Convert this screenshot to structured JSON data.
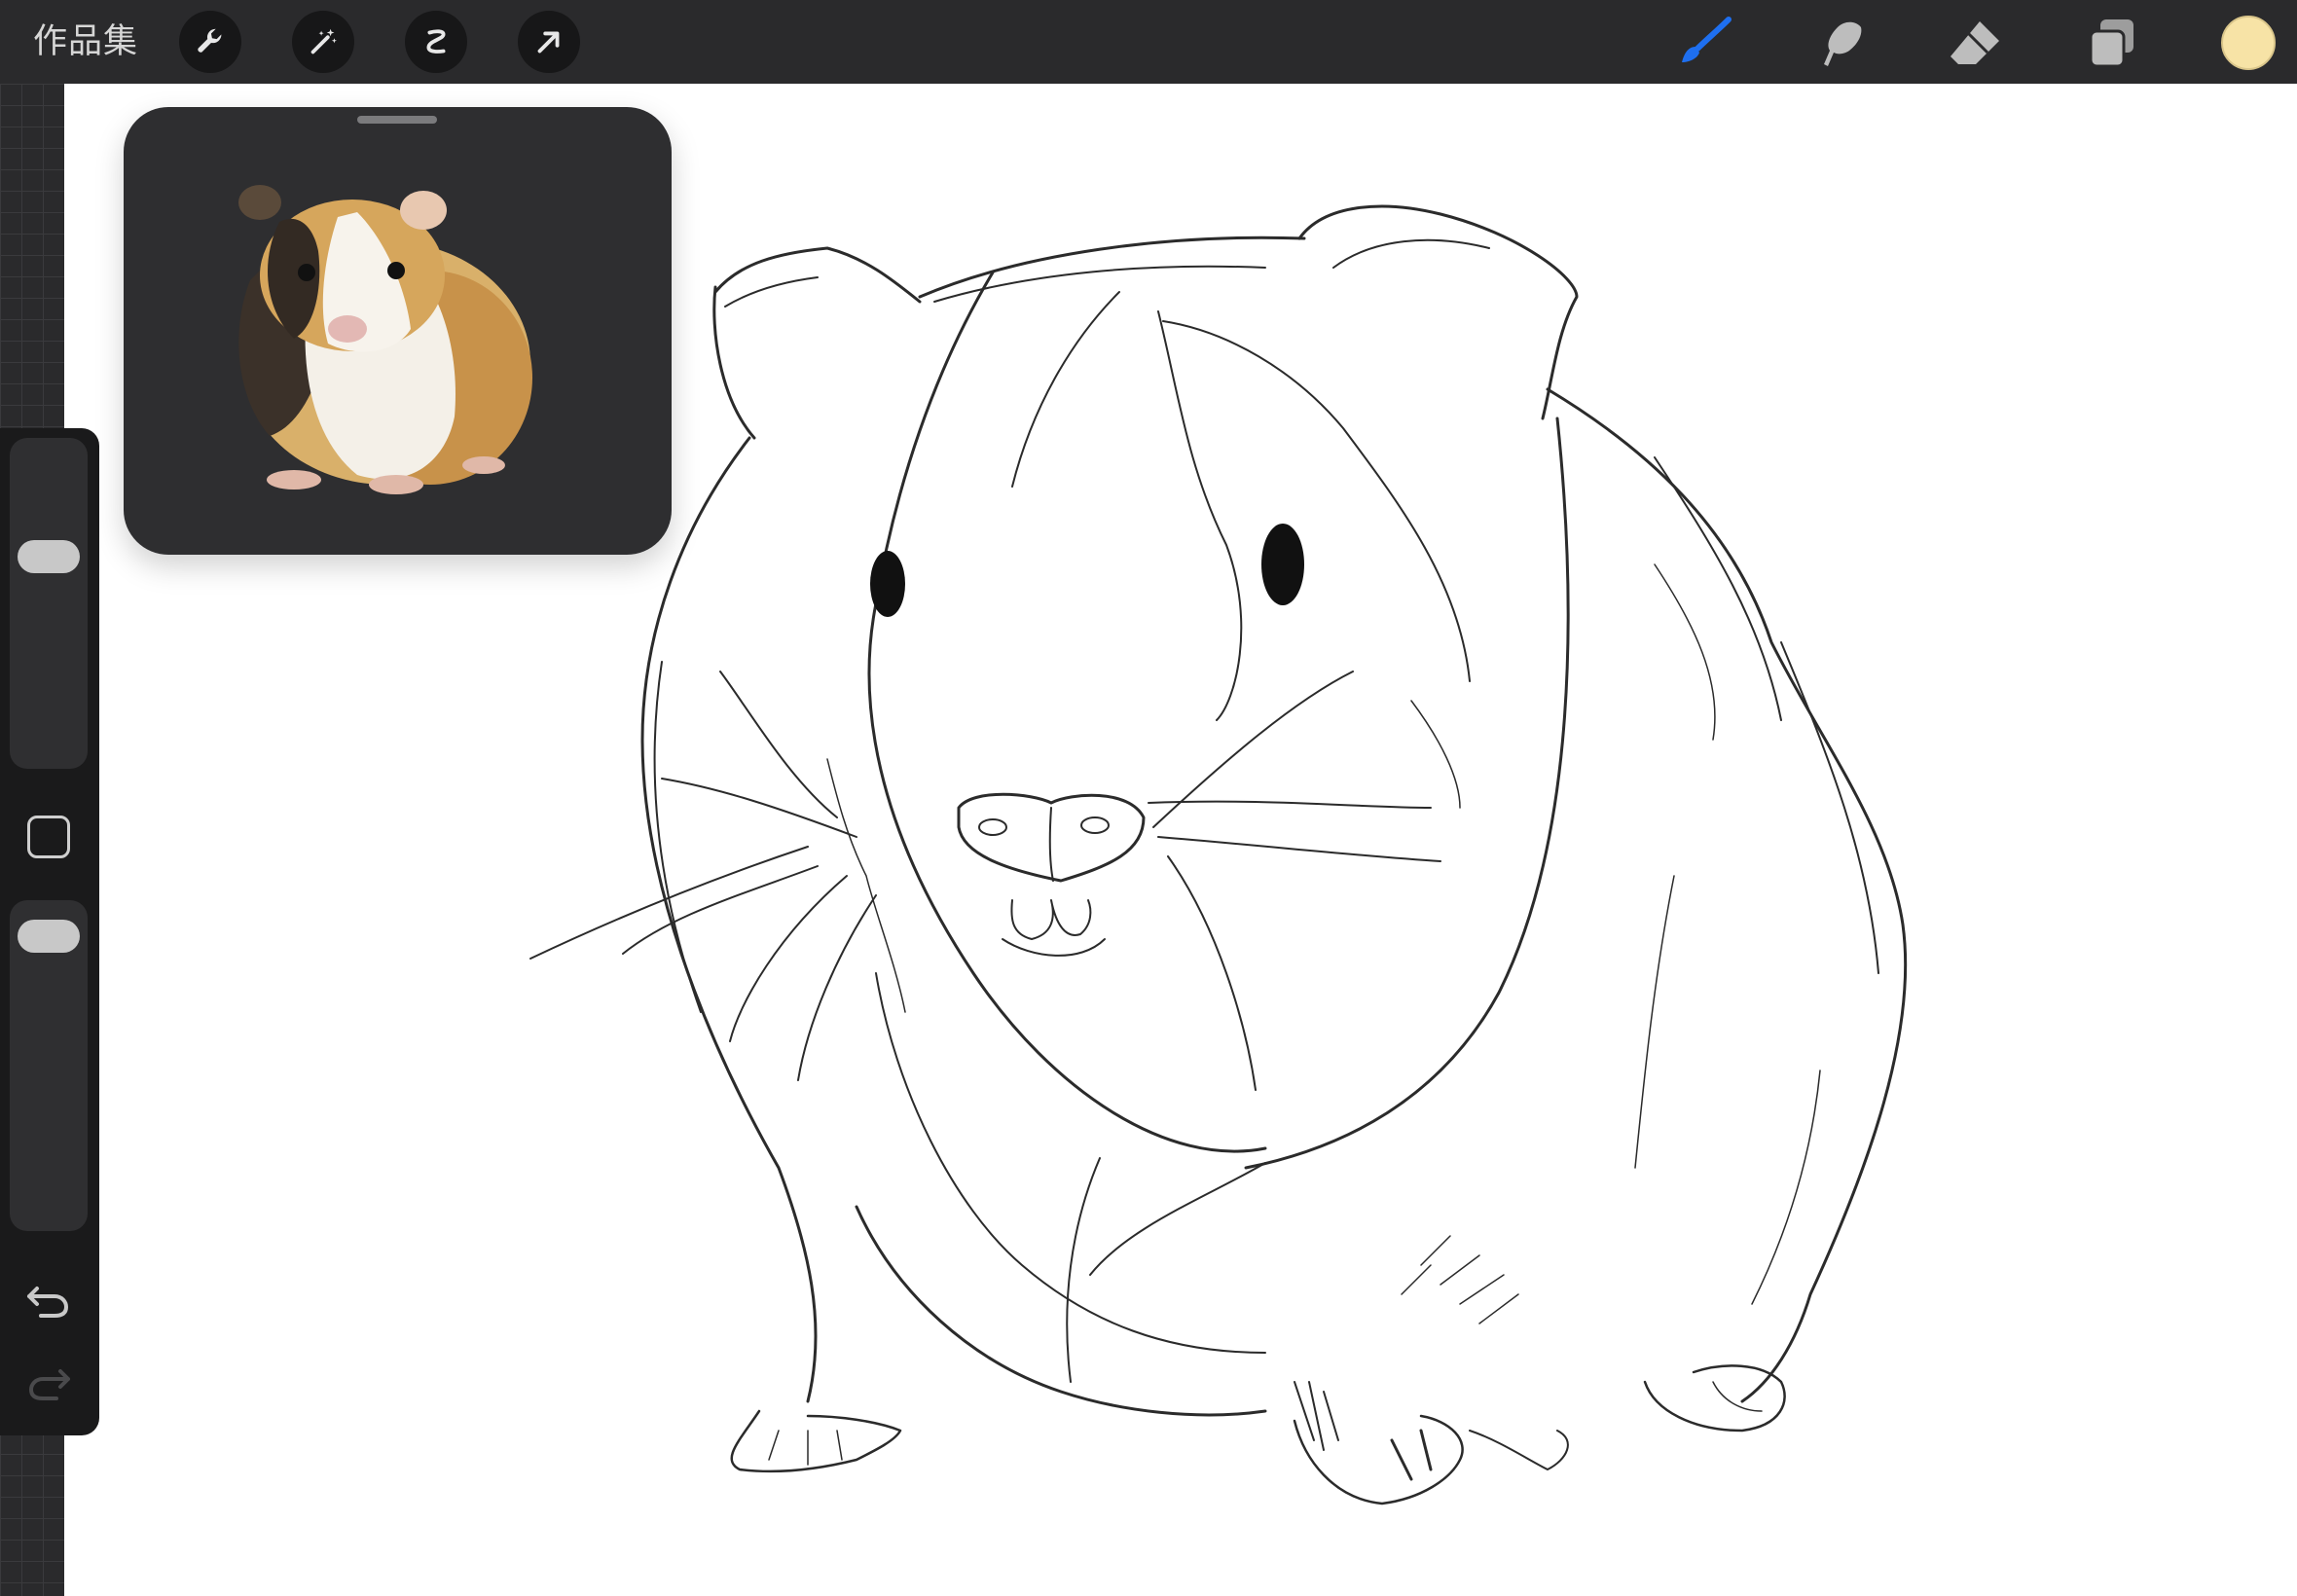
{
  "toolbar": {
    "gallery_label": "作品集",
    "left_tools": [
      "wrench-icon",
      "magic-wand-icon",
      "selection-icon",
      "move-arrow-icon"
    ],
    "right_tools": [
      "brush-icon",
      "smudge-icon",
      "eraser-icon",
      "layers-icon"
    ],
    "active_tool": "brush-icon",
    "current_color": "#f7e3a6",
    "accent": "#1e6ff0"
  },
  "sidebar": {
    "brush_size_slider": "size",
    "opacity_slider": "opacity",
    "icons": [
      "modifier-square-icon",
      "undo-icon",
      "redo-icon"
    ]
  },
  "reference": {
    "window": "reference-image-window",
    "image": "guinea-pig-photo"
  }
}
